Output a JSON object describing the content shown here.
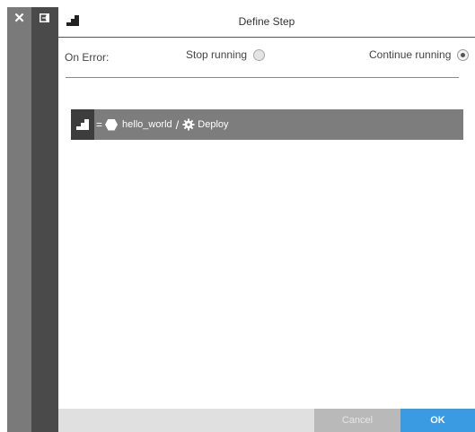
{
  "sidebar": {
    "close_glyph": "✕",
    "close_icon": "close-icon",
    "collapse_icon": "collapse-arrow-icon"
  },
  "header": {
    "title": "Define Step",
    "icon": "step-icon"
  },
  "on_error": {
    "label": "On Error:",
    "options": [
      {
        "label": "Stop running",
        "selected": false
      },
      {
        "label": "Continue running",
        "selected": true
      }
    ]
  },
  "step": {
    "equals": "=",
    "app_icon": "hexagon-icon",
    "app_name": "hello_world",
    "separator": "/",
    "action_icon": "gear-icon",
    "action_name": "Deploy"
  },
  "footer": {
    "cancel_label": "Cancel",
    "ok_label": "OK"
  },
  "colors": {
    "ok": "#3a9be2",
    "step_bar": "#7d7d7d",
    "rail": "#7a7a7a",
    "rail_dark": "#4a4a4a"
  }
}
